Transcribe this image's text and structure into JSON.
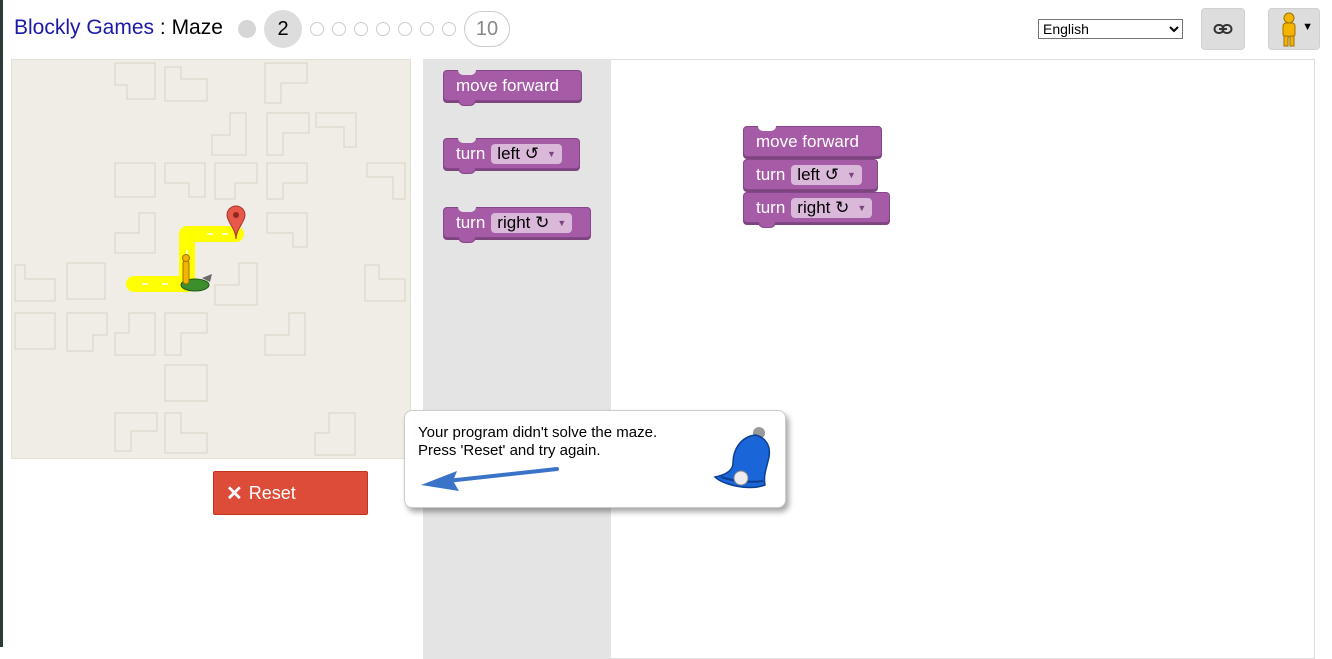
{
  "header": {
    "app_title": "Blockly Games",
    "separator": " : ",
    "game_title": "Maze",
    "current_level": "2",
    "last_level": "10",
    "language": "English"
  },
  "buttons": {
    "reset_label": "Reset",
    "reset_icon": "close-x-icon",
    "link_icon": "link-icon",
    "pegman_icon": "pegman-icon"
  },
  "toolbox": {
    "blocks": [
      {
        "label": "move forward"
      },
      {
        "label": "turn",
        "field": "left ↺"
      },
      {
        "label": "turn",
        "field": "right ↻"
      }
    ]
  },
  "workspace": {
    "blocks": [
      {
        "label": "move forward"
      },
      {
        "label": "turn",
        "field": "left ↺"
      },
      {
        "label": "turn",
        "field": "right ↻"
      }
    ]
  },
  "dialog": {
    "line1": "Your program didn't solve the maze.",
    "line2": "Press 'Reset' and try again.",
    "icon": "bell-icon"
  },
  "colors": {
    "block": "#a55ba5",
    "reset": "#dd4b39",
    "path": "#ffff00",
    "title_link": "#1a1aa6"
  }
}
